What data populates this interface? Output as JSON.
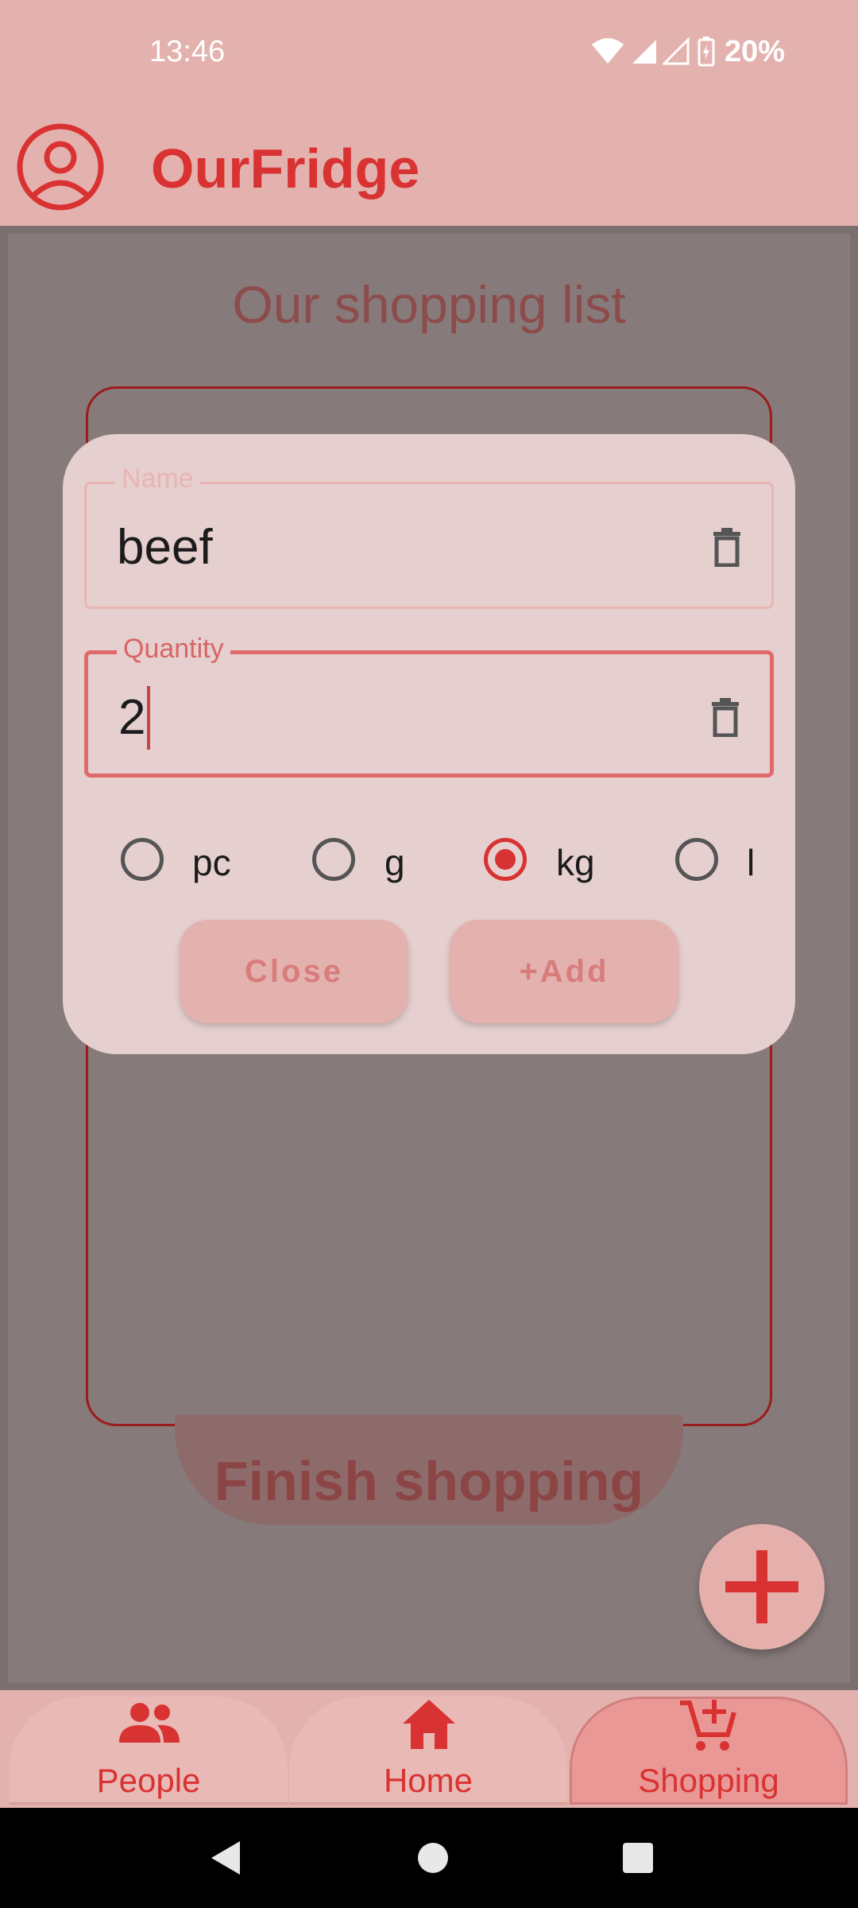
{
  "status_bar": {
    "time": "13:46",
    "battery": "20%",
    "icons": [
      "wifi-icon",
      "signal-icon",
      "signal-icon",
      "battery-icon"
    ]
  },
  "app": {
    "title": "OurFridge",
    "profile_icon": "account-circle-icon",
    "accent": "#d93232"
  },
  "main": {
    "title": "Our shopping list",
    "finish_label": "Finish shopping"
  },
  "dialog": {
    "name": {
      "label": "Name",
      "value": "beef"
    },
    "quantity": {
      "label": "Quantity",
      "value": "2"
    },
    "units": [
      {
        "label": "pc",
        "selected": false
      },
      {
        "label": "g",
        "selected": false
      },
      {
        "label": "kg",
        "selected": true
      },
      {
        "label": "l",
        "selected": false
      }
    ],
    "close_label": "Close",
    "add_label": "+Add"
  },
  "bottom_nav": {
    "items": [
      {
        "label": "People",
        "icon": "people-icon"
      },
      {
        "label": "Home",
        "icon": "home-icon"
      },
      {
        "label": "Shopping",
        "icon": "cart-add-icon",
        "active": true
      }
    ]
  }
}
